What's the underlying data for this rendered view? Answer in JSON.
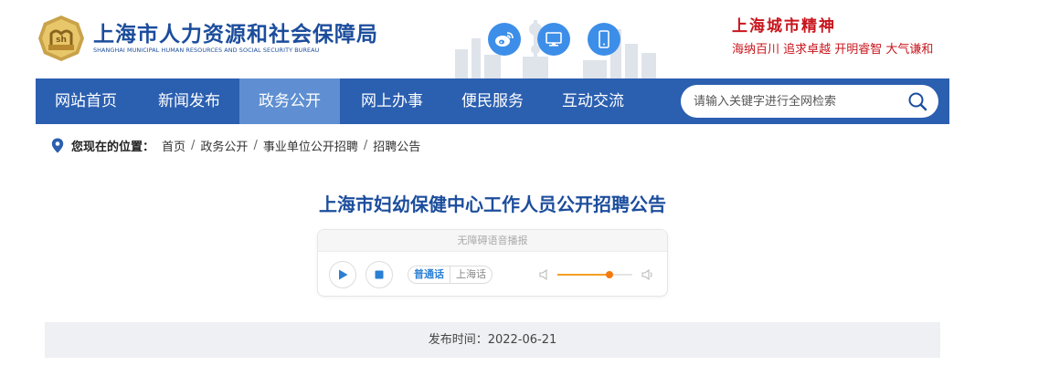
{
  "header": {
    "site_title": "上海市人力资源和社会保障局",
    "site_subtitle": "SHANGHAI MUNICIPAL HUMAN RESOURCES AND SOCIAL SECURITY BUREAU",
    "logo_text": "sh",
    "icons": [
      "weibo-icon",
      "desktop-icon",
      "mobile-icon"
    ],
    "spirit_title": "上海城市精神",
    "spirit_text": "海纳百川  追求卓越  开明睿智  大气谦和"
  },
  "nav": {
    "items": [
      {
        "label": "网站首页",
        "active": false
      },
      {
        "label": "新闻发布",
        "active": false
      },
      {
        "label": "政务公开",
        "active": true
      },
      {
        "label": "网上办事",
        "active": false
      },
      {
        "label": "便民服务",
        "active": false
      },
      {
        "label": "互动交流",
        "active": false
      }
    ],
    "search_placeholder": "请输入关键字进行全网检索"
  },
  "breadcrumb": {
    "label": "您现在的位置：",
    "items": [
      "首页",
      "政务公开",
      "事业单位公开招聘",
      "招聘公告"
    ]
  },
  "article": {
    "title": "上海市妇幼保健中心工作人员公开招聘公告",
    "publish_time": "发布时间：2022-06-21"
  },
  "player": {
    "header": "无障碍语音播报",
    "languages": [
      "普通话",
      "上海话"
    ],
    "selected_language": "普通话",
    "volume": 0.7
  },
  "colors": {
    "brand_blue": "#1c4d9c",
    "nav_bg": "#2b5fb0",
    "nav_active": "#5f8fd2",
    "accent_red": "#c8161d",
    "icon_blue": "#3d8ee8",
    "volume_orange": "#f47a10"
  }
}
